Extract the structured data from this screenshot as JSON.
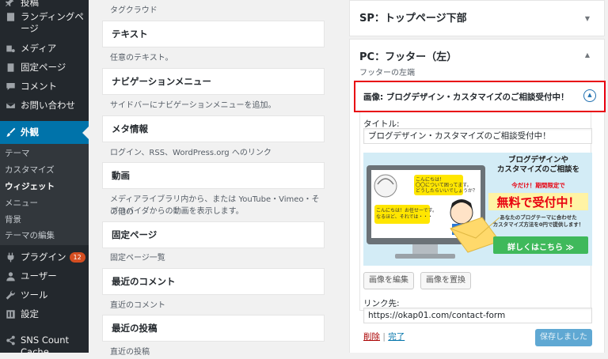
{
  "sidebar": {
    "items": [
      {
        "label": "投稿",
        "icon": "pin-icon"
      },
      {
        "label": "ランディングページ",
        "icon": "page-icon"
      },
      {
        "label": "メディア",
        "icon": "media-icon"
      },
      {
        "label": "固定ページ",
        "icon": "page-icon"
      },
      {
        "label": "コメント",
        "icon": "comment-icon"
      },
      {
        "label": "お問い合わせ",
        "icon": "mail-icon"
      },
      {
        "label": "外観",
        "icon": "brush-icon"
      },
      {
        "label": "プラグイン",
        "icon": "plugin-icon"
      },
      {
        "label": "ユーザー",
        "icon": "user-icon"
      },
      {
        "label": "ツール",
        "icon": "wrench-icon"
      },
      {
        "label": "設定",
        "icon": "settings-icon"
      },
      {
        "label": "SNS Count Cache",
        "icon": "share-icon"
      }
    ],
    "plugin_badge": "12",
    "submenu": [
      "テーマ",
      "カスタマイズ",
      "ウィジェット",
      "メニュー",
      "背景",
      "テーマの編集"
    ]
  },
  "widgets": {
    "tagcloud_desc": "タグクラウド",
    "list": [
      {
        "title": "テキスト",
        "desc": "任意のテキスト。",
        "desc2": ""
      },
      {
        "title": "ナビゲーションメニュー",
        "desc": "サイドバーにナビゲーションメニューを追加。",
        "desc2": ""
      },
      {
        "title": "メタ情報",
        "desc": "ログイン、RSS、WordPress.org へのリンク",
        "desc2": ""
      },
      {
        "title": "動画",
        "desc": "メディアライブラリ内から、または YouTube・Vimeo・その他の",
        "desc2": "プロバイダからの動画を表示します。"
      },
      {
        "title": "固定ページ",
        "desc": "固定ページ一覧",
        "desc2": ""
      },
      {
        "title": "最近のコメント",
        "desc": "直近のコメント",
        "desc2": ""
      },
      {
        "title": "最近の投稿",
        "desc": "直近の投稿",
        "desc2": ""
      }
    ]
  },
  "right": {
    "sp_footer_title": "SP：トップページ下部",
    "pc_footer_title": "PC：フッター（左）",
    "pc_footer_desc": "フッターの左端",
    "image_widget_header": "画像: ブログデザイン・カスタマイズのご相談受付中！",
    "title_label": "タイトル:",
    "title_value": "ブログデザイン・カスタマイズのご相談受付中！",
    "edit_image": "画像を編集",
    "replace_image": "画像を置換",
    "link_label": "リンク先:",
    "link_value": "https://okap01.com/contact-form",
    "delete": "削除",
    "separator": "|",
    "done": "完了",
    "saved": "保存しました"
  },
  "ad": {
    "bubble1": "こんにちは！",
    "bubble1b": "〇〇について困ってます。",
    "bubble1c": "どうしたらいいでしょうか？",
    "bubble2": "こんにちは！お任せーです。",
    "bubble2b": "なるほど、それでは・・・",
    "heading1": "ブログデザインや",
    "heading2": "カスタマイズのご相談を",
    "promo": "今だけ！期間限定で",
    "free": "無料で受付中！",
    "sub1": "あなたのブログテーマに合わせた",
    "sub2": "カスタマイズ方法を0円で提供します！",
    "cta": "詳しくはこちら ≫"
  },
  "colors": {
    "sidebar": "#23282d",
    "active": "#0073aa",
    "highlight": "#e8000f",
    "green": "#3fb95b",
    "accent_blue": "#2271b1"
  }
}
